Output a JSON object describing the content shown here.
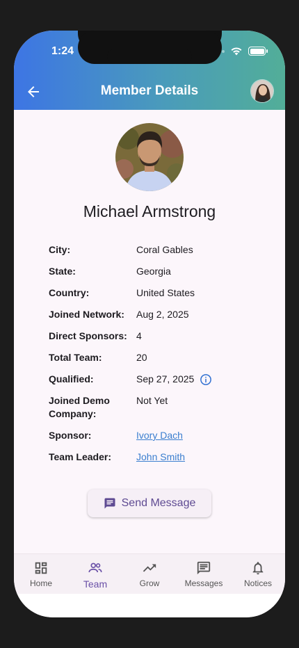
{
  "status": {
    "time": "1:24"
  },
  "header": {
    "title": "Member Details"
  },
  "member": {
    "name": "Michael Armstrong",
    "details": [
      {
        "label": "City:",
        "value": "Coral Gables"
      },
      {
        "label": "State:",
        "value": "Georgia"
      },
      {
        "label": "Country:",
        "value": "United States"
      },
      {
        "label": "Joined Network:",
        "value": "Aug 2, 2025"
      },
      {
        "label": "Direct Sponsors:",
        "value": "4"
      },
      {
        "label": "Total Team:",
        "value": "20"
      },
      {
        "label": "Qualified:",
        "value": "Sep 27, 2025"
      },
      {
        "label": "Joined Demo Company:",
        "value": "Not Yet"
      },
      {
        "label": "Sponsor:",
        "value": "Ivory Dach"
      },
      {
        "label": "Team Leader:",
        "value": "John Smith"
      }
    ]
  },
  "actions": {
    "send_message": "Send Message"
  },
  "nav": {
    "items": [
      {
        "label": "Home",
        "icon": "dashboard-icon"
      },
      {
        "label": "Team",
        "icon": "people-icon"
      },
      {
        "label": "Grow",
        "icon": "trending-up-icon"
      },
      {
        "label": "Messages",
        "icon": "chat-icon"
      },
      {
        "label": "Notices",
        "icon": "bell-icon"
      }
    ],
    "active": "Team"
  },
  "colors": {
    "header_gradient_start": "#3d75e4",
    "header_gradient_end": "#52ae98",
    "link": "#3a7ecf",
    "accent": "#6a50a7",
    "background": "#fcf6fb"
  }
}
